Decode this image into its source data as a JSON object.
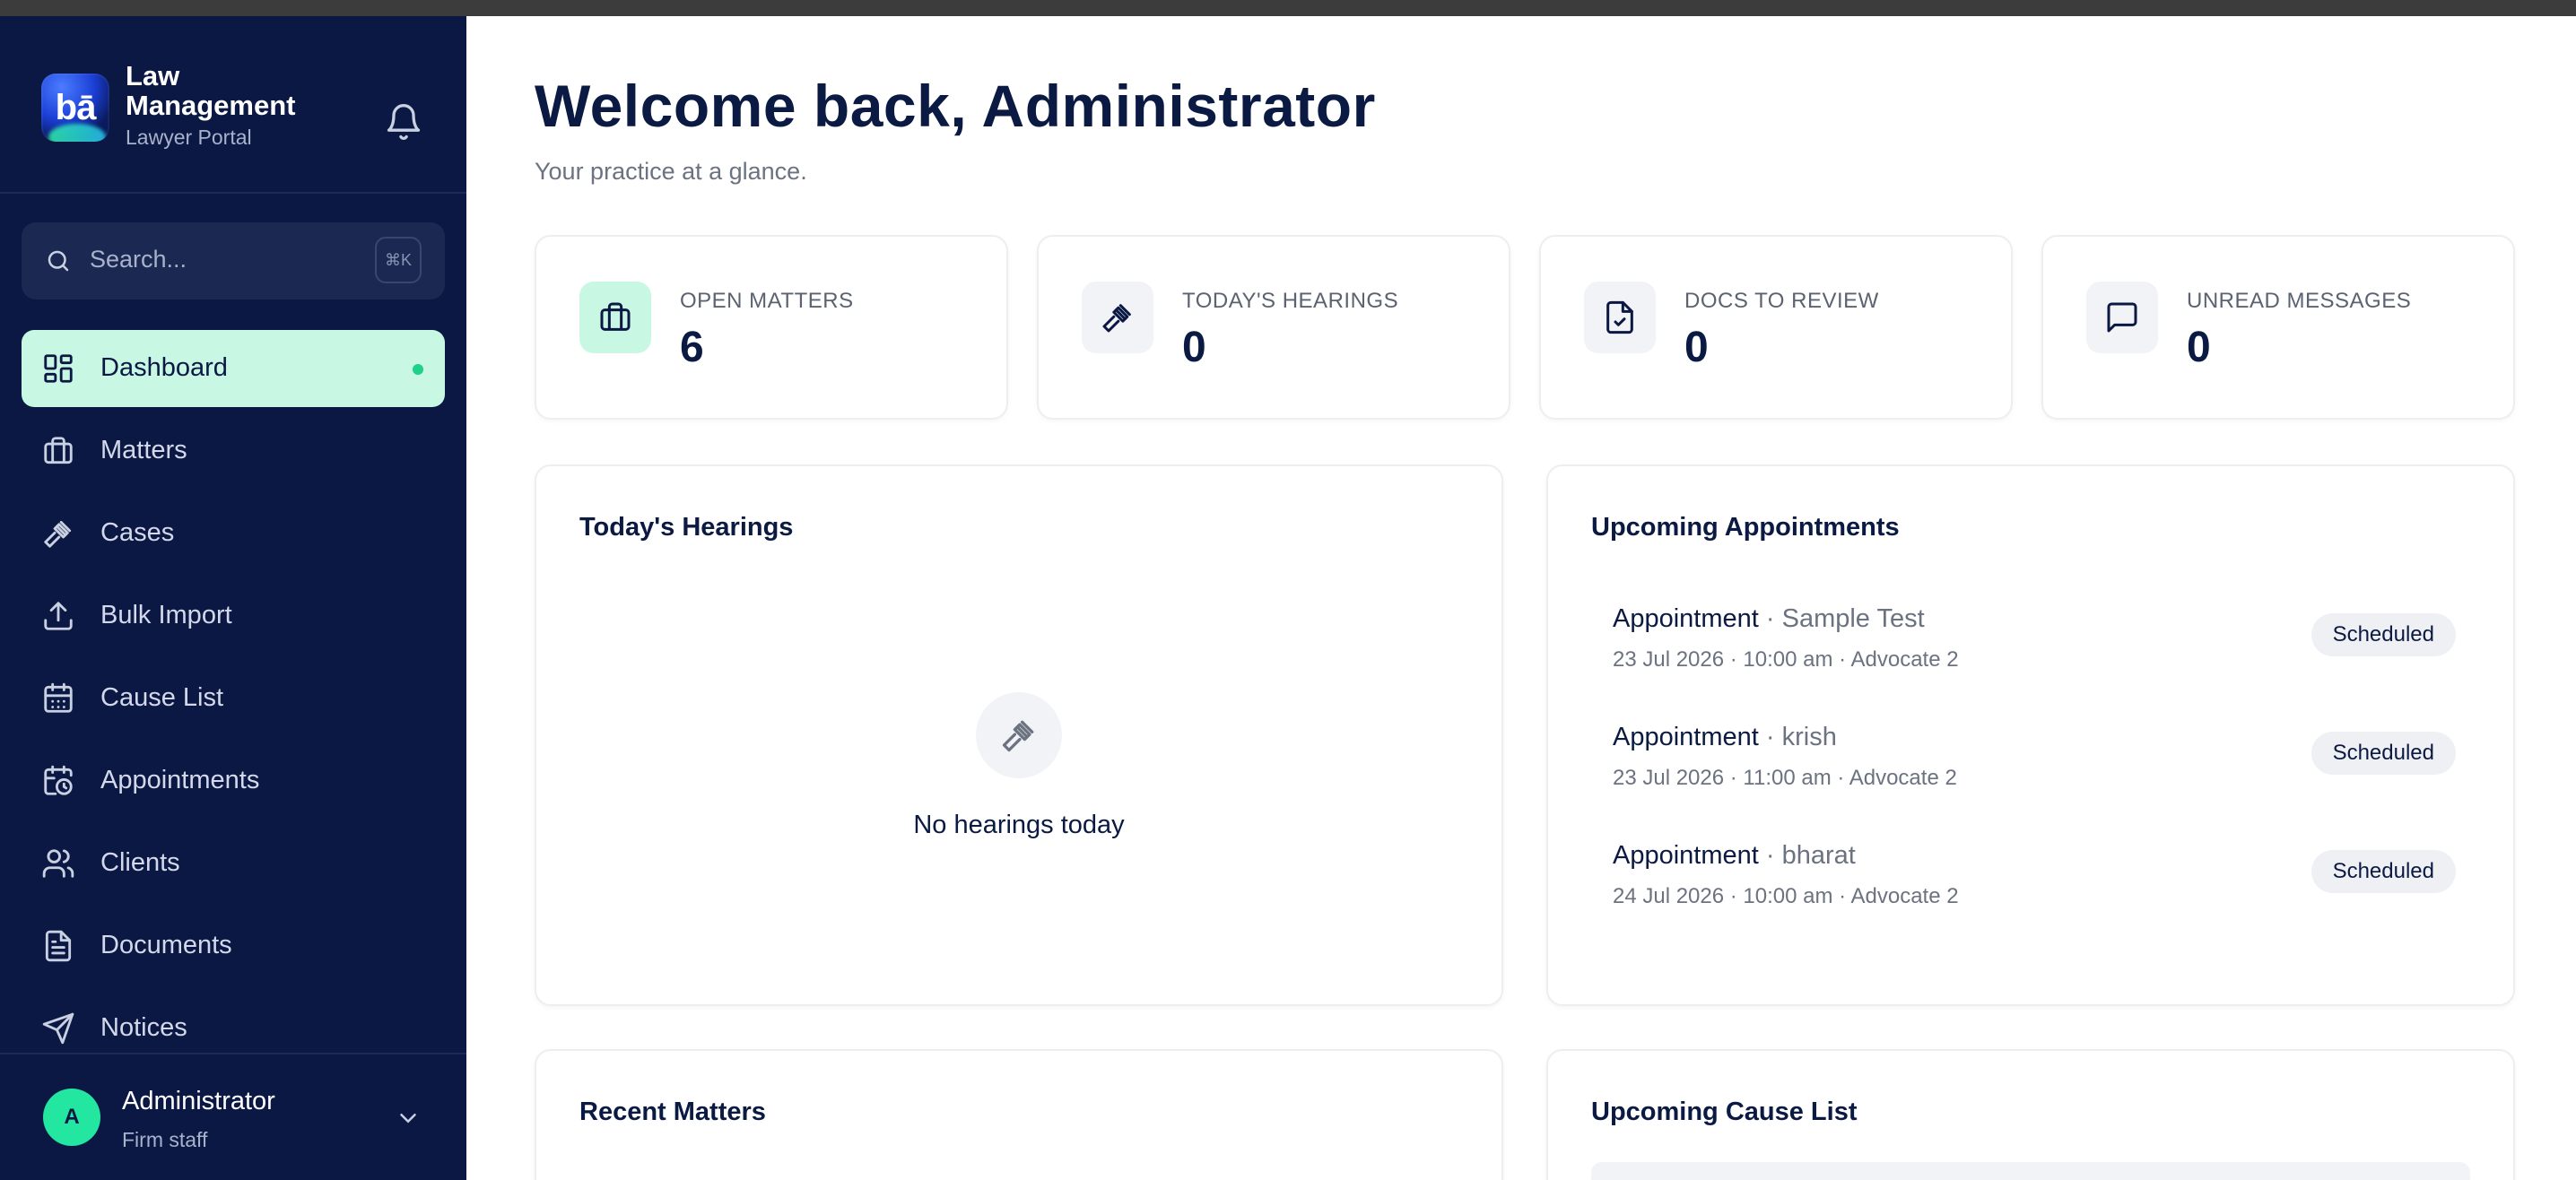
{
  "brand": {
    "logo_text": "bā",
    "title": "Law Management",
    "subtitle": "Lawyer Portal"
  },
  "search": {
    "placeholder": "Search...",
    "shortcut": "⌘K"
  },
  "sidebar": {
    "items": [
      {
        "label": "Dashboard",
        "icon": "dashboard-icon",
        "active": true
      },
      {
        "label": "Matters",
        "icon": "briefcase-icon"
      },
      {
        "label": "Cases",
        "icon": "gavel-icon"
      },
      {
        "label": "Bulk Import",
        "icon": "upload-icon"
      },
      {
        "label": "Cause List",
        "icon": "calendar-icon"
      },
      {
        "label": "Appointments",
        "icon": "calendar-clock-icon"
      },
      {
        "label": "Clients",
        "icon": "users-icon"
      },
      {
        "label": "Documents",
        "icon": "document-icon"
      },
      {
        "label": "Notices",
        "icon": "send-icon"
      }
    ]
  },
  "user": {
    "initial": "A",
    "name": "Administrator",
    "role": "Firm staff"
  },
  "main": {
    "title": "Welcome back, Administrator",
    "subtitle": "Your practice at a glance.",
    "stats": [
      {
        "label": "OPEN MATTERS",
        "value": "6",
        "icon": "briefcase-icon"
      },
      {
        "label": "TODAY'S HEARINGS",
        "value": "0",
        "icon": "gavel-icon"
      },
      {
        "label": "DOCS TO REVIEW",
        "value": "0",
        "icon": "document-check-icon"
      },
      {
        "label": "UNREAD MESSAGES",
        "value": "0",
        "icon": "message-icon"
      }
    ],
    "hearings": {
      "title": "Today's Hearings",
      "empty_text": "No hearings today"
    },
    "appointments": {
      "title": "Upcoming Appointments",
      "items": [
        {
          "kind": "Appointment",
          "sep": " · ",
          "with": "Sample Test",
          "meta": "23 Jul 2026 · 10:00 am · Advocate 2",
          "status": "Scheduled"
        },
        {
          "kind": "Appointment",
          "sep": " · ",
          "with": "krish",
          "meta": "23 Jul 2026 · 11:00 am · Advocate 2",
          "status": "Scheduled"
        },
        {
          "kind": "Appointment",
          "sep": " · ",
          "with": "bharat",
          "meta": "24 Jul 2026 · 10:00 am · Advocate 2",
          "status": "Scheduled"
        }
      ]
    },
    "recent_matters": {
      "title": "Recent Matters"
    },
    "cause_list": {
      "title": "Upcoming Cause List"
    }
  },
  "colors": {
    "sidebar_bg": "#0b1844",
    "accent": "#23e6a0",
    "active_bg": "#c8f7e3",
    "text_dark": "#0b1a42"
  }
}
